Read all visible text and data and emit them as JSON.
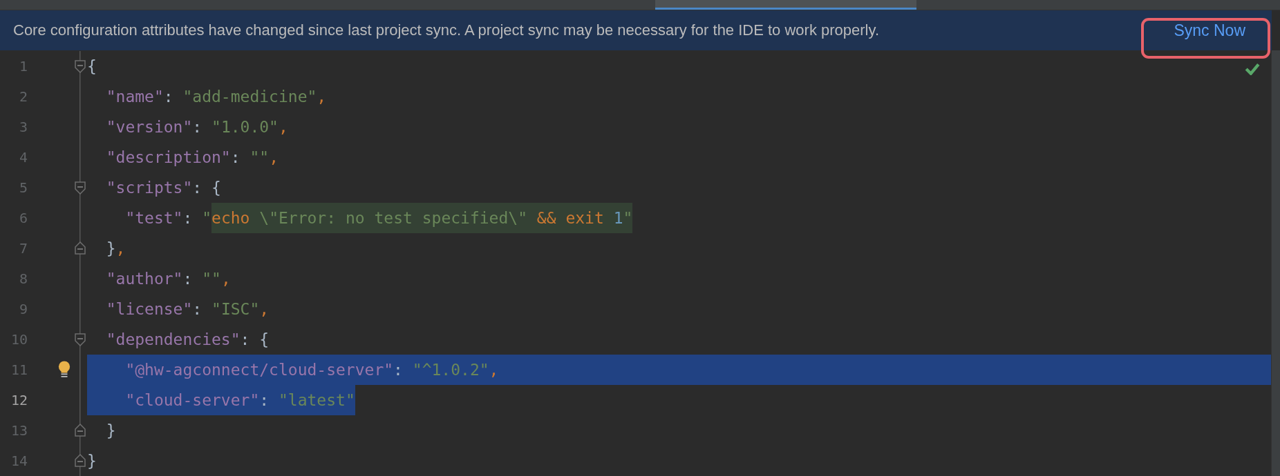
{
  "notification": {
    "message": "Core configuration attributes have changed since last project sync. A project sync may be necessary for the IDE to work properly.",
    "action": "Sync Now",
    "outlined": true
  },
  "inspection": {
    "passed": true
  },
  "editor": {
    "lines": [
      {
        "number": "1",
        "current": false,
        "selected": false,
        "fold_open": true,
        "tokens": [
          {
            "kind": "punct",
            "text": "{"
          }
        ]
      },
      {
        "number": "2",
        "current": false,
        "selected": false,
        "tokens": [
          {
            "kind": "key",
            "text": "  \"name\""
          },
          {
            "kind": "punct",
            "text": ": "
          },
          {
            "kind": "string",
            "text": "\"add-medicine\""
          },
          {
            "kind": "comma",
            "text": ","
          }
        ]
      },
      {
        "number": "3",
        "current": false,
        "selected": false,
        "tokens": [
          {
            "kind": "key",
            "text": "  \"version\""
          },
          {
            "kind": "punct",
            "text": ": "
          },
          {
            "kind": "string",
            "text": "\"1.0.0\""
          },
          {
            "kind": "comma",
            "text": ","
          }
        ]
      },
      {
        "number": "4",
        "current": false,
        "selected": false,
        "tokens": [
          {
            "kind": "key",
            "text": "  \"description\""
          },
          {
            "kind": "punct",
            "text": ": "
          },
          {
            "kind": "string",
            "text": "\"\""
          },
          {
            "kind": "comma",
            "text": ","
          }
        ]
      },
      {
        "number": "5",
        "current": false,
        "selected": false,
        "fold_open": true,
        "tokens": [
          {
            "kind": "key",
            "text": "  \"scripts\""
          },
          {
            "kind": "punct",
            "text": ": {"
          }
        ]
      },
      {
        "number": "6",
        "current": false,
        "selected": false,
        "tokens": [
          {
            "kind": "key",
            "text": "    \"test\""
          },
          {
            "kind": "punct",
            "text": ": "
          },
          {
            "kind": "string",
            "text": "\""
          },
          {
            "kind": "injected",
            "tokens": [
              {
                "kind": "keyword",
                "text": "echo"
              },
              {
                "kind": "string",
                "text": " \\\"Error: no test specified\\\" "
              },
              {
                "kind": "keyword",
                "text": "&& exit "
              },
              {
                "kind": "number",
                "text": "1"
              },
              {
                "kind": "string",
                "text": "\""
              }
            ]
          }
        ]
      },
      {
        "number": "7",
        "current": false,
        "selected": false,
        "fold_close": true,
        "tokens": [
          {
            "kind": "punct",
            "text": "  }"
          },
          {
            "kind": "comma",
            "text": ","
          }
        ]
      },
      {
        "number": "8",
        "current": false,
        "selected": false,
        "tokens": [
          {
            "kind": "key",
            "text": "  \"author\""
          },
          {
            "kind": "punct",
            "text": ": "
          },
          {
            "kind": "string",
            "text": "\"\""
          },
          {
            "kind": "comma",
            "text": ","
          }
        ]
      },
      {
        "number": "9",
        "current": false,
        "selected": false,
        "tokens": [
          {
            "kind": "key",
            "text": "  \"license\""
          },
          {
            "kind": "punct",
            "text": ": "
          },
          {
            "kind": "string",
            "text": "\"ISC\""
          },
          {
            "kind": "comma",
            "text": ","
          }
        ]
      },
      {
        "number": "10",
        "current": false,
        "selected": false,
        "fold_open": true,
        "tokens": [
          {
            "kind": "key",
            "text": "  \"dependencies\""
          },
          {
            "kind": "punct",
            "text": ": {"
          }
        ]
      },
      {
        "number": "11",
        "current": false,
        "selected": true,
        "selection_to_end": true,
        "bulb": true,
        "tokens": [
          {
            "kind": "key",
            "text": "    \"@hw-agconnect/cloud-server\""
          },
          {
            "kind": "punct",
            "text": ": "
          },
          {
            "kind": "string",
            "text": "\"^1.0.2\""
          },
          {
            "kind": "comma",
            "text": ","
          }
        ]
      },
      {
        "number": "12",
        "current": true,
        "selected": true,
        "selection_to_end": false,
        "tokens": [
          {
            "kind": "key",
            "text": "    \"cloud-server\""
          },
          {
            "kind": "punct",
            "text": ": "
          },
          {
            "kind": "string",
            "text": "\"latest\""
          }
        ]
      },
      {
        "number": "13",
        "current": false,
        "selected": false,
        "fold_close": true,
        "tokens": [
          {
            "kind": "punct",
            "text": "  }"
          }
        ]
      },
      {
        "number": "14",
        "current": false,
        "selected": false,
        "fold_close": true,
        "tokens": [
          {
            "kind": "punct",
            "text": "}"
          }
        ]
      }
    ]
  }
}
